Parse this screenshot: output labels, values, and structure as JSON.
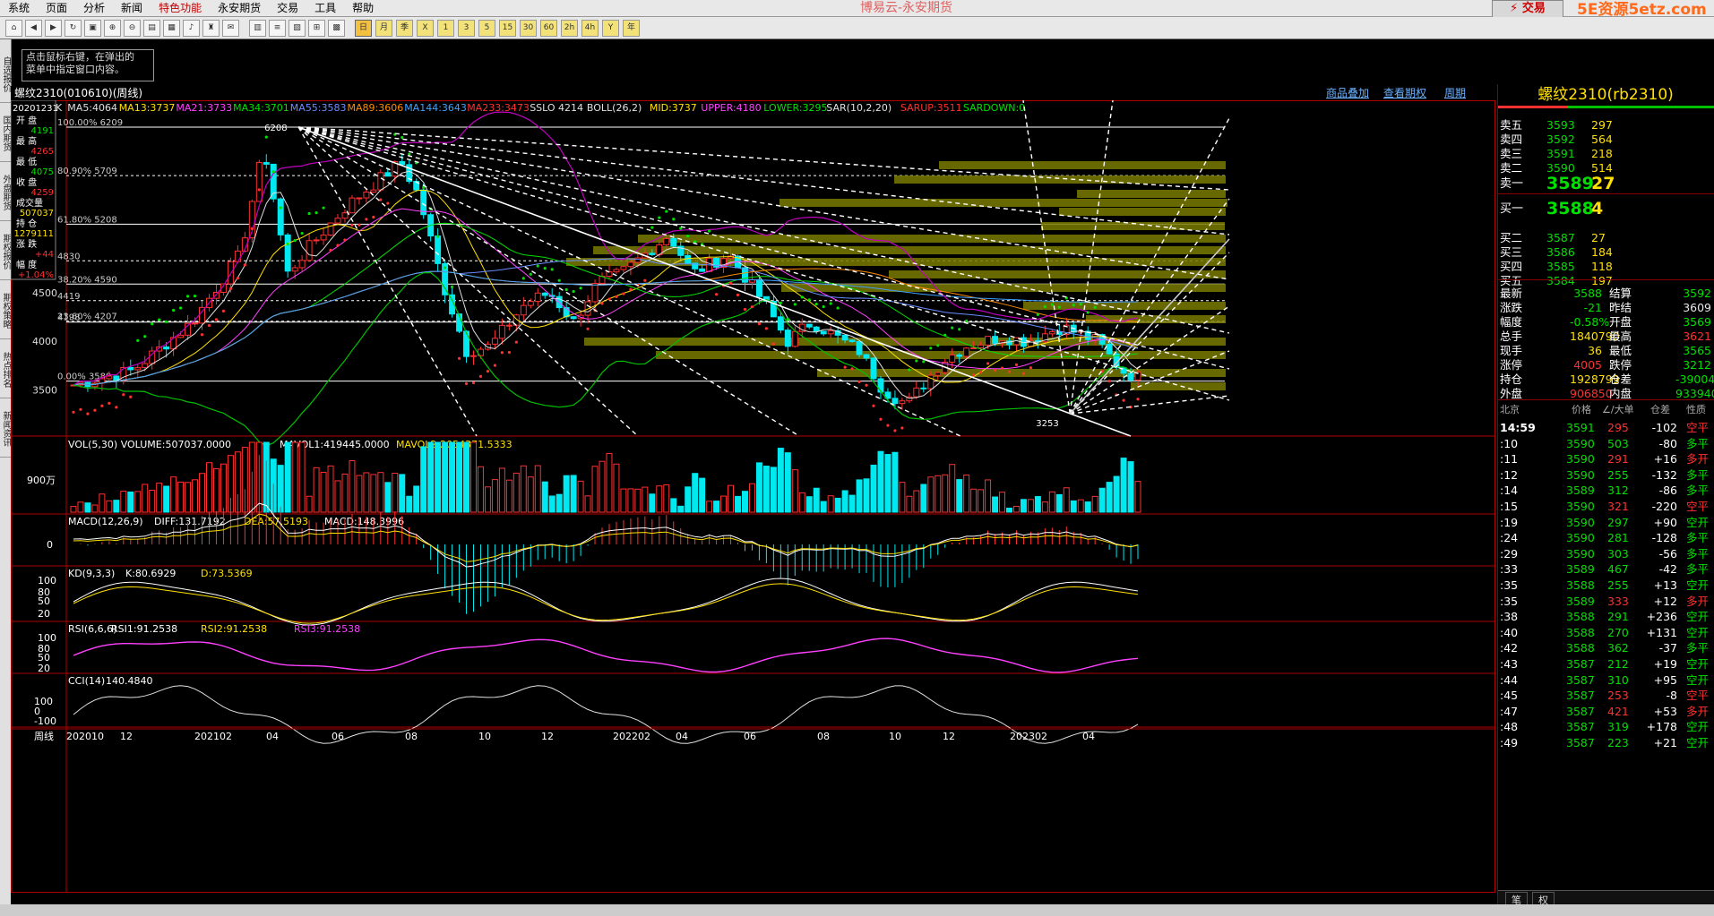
{
  "menu": [
    "系统",
    "页面",
    "分析",
    "新闻",
    "特色功能",
    "永安期货",
    "交易",
    "工具",
    "帮助"
  ],
  "menu_active": "特色功能",
  "app_title": "博易云-永安期货",
  "trade_button": "⚡ 交易",
  "watermark": "5E资源5etz.com",
  "toolbar_icons": [
    "home-icon",
    "back-icon",
    "forward-icon",
    "refresh-icon",
    "window-icon",
    "zoom-in-icon",
    "zoom-out-icon",
    "layout-icon",
    "grid-icon",
    "bell-icon",
    "trophy-icon",
    "news-icon",
    "table-icon",
    "list-icon",
    "chart-icon",
    "weekly-icon",
    "daily-icon"
  ],
  "period_buttons": [
    "日",
    "月",
    "季",
    "X",
    "1",
    "3",
    "5",
    "15",
    "30",
    "60",
    "2h",
    "4h",
    "Y",
    "年"
  ],
  "left_tabs": [
    "自选报价",
    "国内期货",
    "外盘期货",
    "期权报价",
    "期权策略",
    "热点排名",
    "新闻资讯"
  ],
  "tooltip": {
    "line1": "点击鼠标右键，在弹出的",
    "line2": "菜单中指定窗口内容。"
  },
  "chart_header": {
    "title": "螺纹2310(010610)(周线)",
    "link_overlay": "商品叠加",
    "link_options": "查看期权",
    "link_period": "周期"
  },
  "indicator_line": [
    {
      "text": "K",
      "color": "#e0e0e0"
    },
    {
      "text": "MA5:4064",
      "color": "#e0e0e0"
    },
    {
      "text": "MA13:3737",
      "color": "#ffe000"
    },
    {
      "text": "MA21:3733",
      "color": "#ff40ff"
    },
    {
      "text": "MA34:3701",
      "color": "#00e000"
    },
    {
      "text": "MA55:3583",
      "color": "#6a8cff"
    },
    {
      "text": "MA89:3606",
      "color": "#ff8c00"
    },
    {
      "text": "MA144:3643",
      "color": "#40a0ff"
    },
    {
      "text": "MA233:3473",
      "color": "#ff3030"
    },
    {
      "text": "SSLO 4214",
      "color": "#e0e0e0"
    },
    {
      "text": "BOLL(26,2)",
      "color": "#e0e0e0"
    },
    {
      "text": "MID:3737",
      "color": "#ffe000"
    },
    {
      "text": "UPPER:4180",
      "color": "#ff40ff"
    },
    {
      "text": "LOWER:3295",
      "color": "#00e000"
    },
    {
      "text": "SAR(10,2,20)",
      "color": "#e0e0e0"
    },
    {
      "text": "SARUP:3511",
      "color": "#ff3030"
    },
    {
      "text": "SARDOWN:0",
      "color": "#00e000"
    }
  ],
  "info_box": {
    "date": "20201231",
    "rows": [
      {
        "label": "开 盘",
        "value": "4191",
        "color": "#00e000"
      },
      {
        "label": "最 高",
        "value": "4265",
        "color": "#ff3030"
      },
      {
        "label": "最 低",
        "value": "4075",
        "color": "#00e000"
      },
      {
        "label": "收 盘",
        "value": "4259",
        "color": "#ff3030"
      },
      {
        "label": "成交量",
        "value": "507037",
        "color": "#ffe000"
      },
      {
        "label": "持 仓",
        "value": "1279111",
        "color": "#ffe000"
      },
      {
        "label": "涨 跌",
        "value": "+44",
        "color": "#ff3030"
      },
      {
        "label": "幅 度",
        "value": "+1.04%",
        "color": "#ff3030"
      }
    ]
  },
  "price_axis": [
    "4500",
    "4000",
    "3500"
  ],
  "fib_levels": [
    {
      "label": "100.00% 6209",
      "price": 6209
    },
    {
      "label": "80.90% 5709",
      "price": 5709
    },
    {
      "label": "61.80% 5208",
      "price": 5208
    },
    {
      "label": "4830",
      "price": 4830
    },
    {
      "label": "38.20% 4590",
      "price": 4590
    },
    {
      "label": "4419",
      "price": 4419
    },
    {
      "label": "4198",
      "price": 4198
    },
    {
      "label": "23.60% 4207",
      "price": 4207
    },
    {
      "label": "0.00% 3589",
      "price": 3589
    }
  ],
  "high_marker": "6208",
  "low_marker": "3253",
  "volume_panel": {
    "title": "VOL(5,30) VOLUME:507037.0000",
    "mavol1": "MAVOL1:419445.0000",
    "mavol2": "MAVOL2:2054371.5333",
    "axis": "900万"
  },
  "macd_panel": {
    "title": "MACD(12,26,9)",
    "diff": "DIFF:131.7192",
    "dea": "DEA:57.5193",
    "macd": "MACD:148.3996",
    "axis": "0"
  },
  "kd_panel": {
    "title": "KD(9,3,3)",
    "k": "K:80.6929",
    "d": "D:73.5369",
    "axis": [
      "100",
      "80",
      "50",
      "20"
    ]
  },
  "rsi_panel": {
    "title": "RSI(6,6,6)",
    "rsi1": "RSI1:91.2538",
    "rsi2": "RSI2:91.2538",
    "rsi3": "RSI3:91.2538",
    "axis": [
      "100",
      "80",
      "50",
      "20"
    ]
  },
  "cci_panel": {
    "title": "CCI(14)",
    "value": "140.4840",
    "axis": [
      "100",
      "0",
      "-100"
    ]
  },
  "time_axis": {
    "label": "周线",
    "ticks": [
      "202010",
      "12",
      "202102",
      "04",
      "06",
      "08",
      "10",
      "12",
      "202202",
      "04",
      "06",
      "08",
      "10",
      "12",
      "202302",
      "04"
    ]
  },
  "quote": {
    "title": "螺纹2310(rb2310)",
    "asks": [
      {
        "label": "卖五",
        "price": "3593",
        "vol": "297"
      },
      {
        "label": "卖四",
        "price": "3592",
        "vol": "564"
      },
      {
        "label": "卖三",
        "price": "3591",
        "vol": "218"
      },
      {
        "label": "卖二",
        "price": "3590",
        "vol": "514"
      },
      {
        "label": "卖一",
        "price": "3589",
        "vol": "27"
      }
    ],
    "bids": [
      {
        "label": "买一",
        "price": "3588",
        "vol": "4"
      },
      {
        "label": "买二",
        "price": "3587",
        "vol": "27"
      },
      {
        "label": "买三",
        "price": "3586",
        "vol": "184"
      },
      {
        "label": "买四",
        "price": "3585",
        "vol": "118"
      },
      {
        "label": "买五",
        "price": "3584",
        "vol": "197"
      }
    ],
    "stats": [
      {
        "l1": "最新",
        "v1": "3588",
        "c1": "#00e000",
        "l2": "结算",
        "v2": "3592",
        "c2": "#00e000"
      },
      {
        "l1": "涨跌",
        "v1": "-21",
        "c1": "#00e000",
        "l2": "昨结",
        "v2": "3609",
        "c2": "#e8e8e8"
      },
      {
        "l1": "幅度",
        "v1": "-0.58%",
        "c1": "#00e000",
        "l2": "开盘",
        "v2": "3569",
        "c2": "#00e000"
      },
      {
        "l1": "总手",
        "v1": "1840790",
        "c1": "#ffe000",
        "l2": "最高",
        "v2": "3621",
        "c2": "#ff3030"
      },
      {
        "l1": "现手",
        "v1": "36",
        "c1": "#ffe000",
        "l2": "最低",
        "v2": "3565",
        "c2": "#00e000"
      },
      {
        "l1": "涨停",
        "v1": "4005",
        "c1": "#ff3030",
        "l2": "跌停",
        "v2": "3212",
        "c2": "#00e000"
      },
      {
        "l1": "持仓",
        "v1": "1928799",
        "c1": "#ffe000",
        "l2": "仓差",
        "v2": "-39004",
        "c2": "#00e000"
      },
      {
        "l1": "外盘",
        "v1": "906850",
        "c1": "#ff3030",
        "l2": "内盘",
        "v2": "933940",
        "c2": "#00e000"
      }
    ],
    "tick_header": [
      "北京",
      "价格",
      "∠/大单",
      "仓差",
      "性质"
    ],
    "ticks": [
      {
        "t": "14:59",
        "p": "3591",
        "v": "295",
        "vc": "#ff3030",
        "d": "-102",
        "n": "空平",
        "nc": "#ff3030"
      },
      {
        "t": ":10",
        "p": "3590",
        "v": "503",
        "vc": "#00e000",
        "d": "-80",
        "n": "多平",
        "nc": "#00e000"
      },
      {
        "t": ":11",
        "p": "3590",
        "v": "291",
        "vc": "#ff3030",
        "d": "+16",
        "n": "多开",
        "nc": "#ff3030"
      },
      {
        "t": ":12",
        "p": "3590",
        "v": "255",
        "vc": "#00e000",
        "d": "-132",
        "n": "多平",
        "nc": "#00e000"
      },
      {
        "t": ":14",
        "p": "3589",
        "v": "312",
        "vc": "#00e000",
        "d": "-86",
        "n": "多平",
        "nc": "#00e000"
      },
      {
        "t": ":15",
        "p": "3590",
        "v": "321",
        "vc": "#ff3030",
        "d": "-220",
        "n": "空平",
        "nc": "#ff3030"
      },
      {
        "t": ":19",
        "p": "3590",
        "v": "297",
        "vc": "#00e000",
        "d": "+90",
        "n": "空开",
        "nc": "#00e000"
      },
      {
        "t": ":24",
        "p": "3590",
        "v": "281",
        "vc": "#00e000",
        "d": "-128",
        "n": "多平",
        "nc": "#00e000"
      },
      {
        "t": ":29",
        "p": "3590",
        "v": "303",
        "vc": "#00e000",
        "d": "-56",
        "n": "多平",
        "nc": "#00e000"
      },
      {
        "t": ":33",
        "p": "3589",
        "v": "467",
        "vc": "#00e000",
        "d": "-42",
        "n": "多平",
        "nc": "#00e000"
      },
      {
        "t": ":35",
        "p": "3588",
        "v": "255",
        "vc": "#00e000",
        "d": "+13",
        "n": "空开",
        "nc": "#00e000"
      },
      {
        "t": ":35",
        "p": "3589",
        "v": "333",
        "vc": "#ff3030",
        "d": "+12",
        "n": "多开",
        "nc": "#ff3030"
      },
      {
        "t": ":38",
        "p": "3588",
        "v": "291",
        "vc": "#00e000",
        "d": "+236",
        "n": "空开",
        "nc": "#00e000"
      },
      {
        "t": ":40",
        "p": "3588",
        "v": "270",
        "vc": "#00e000",
        "d": "+131",
        "n": "空开",
        "nc": "#00e000"
      },
      {
        "t": ":42",
        "p": "3588",
        "v": "362",
        "vc": "#00e000",
        "d": "-37",
        "n": "多平",
        "nc": "#00e000"
      },
      {
        "t": ":43",
        "p": "3587",
        "v": "212",
        "vc": "#00e000",
        "d": "+19",
        "n": "空开",
        "nc": "#00e000"
      },
      {
        "t": ":44",
        "p": "3587",
        "v": "310",
        "vc": "#00e000",
        "d": "+95",
        "n": "空开",
        "nc": "#00e000"
      },
      {
        "t": ":45",
        "p": "3587",
        "v": "253",
        "vc": "#ff3030",
        "d": "-8",
        "n": "空平",
        "nc": "#ff3030"
      },
      {
        "t": ":47",
        "p": "3587",
        "v": "421",
        "vc": "#ff3030",
        "d": "+53",
        "n": "多开",
        "nc": "#ff3030"
      },
      {
        "t": ":48",
        "p": "3587",
        "v": "319",
        "vc": "#00e000",
        "d": "+178",
        "n": "空开",
        "nc": "#00e000"
      },
      {
        "t": ":49",
        "p": "3587",
        "v": "223",
        "vc": "#00e000",
        "d": "+21",
        "n": "空开",
        "nc": "#00e000"
      }
    ],
    "footer_tabs": [
      "笔",
      "权"
    ]
  }
}
